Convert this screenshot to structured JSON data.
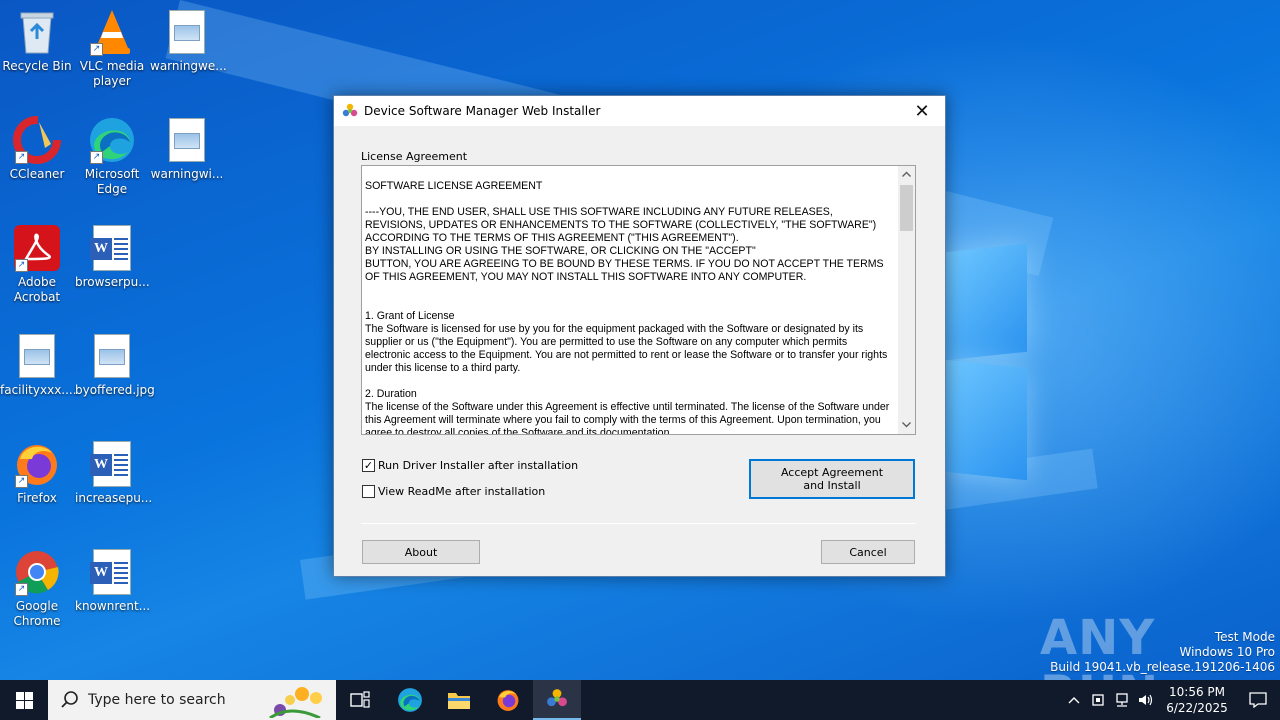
{
  "desktop": {
    "icons": [
      {
        "label": "Recycle Bin",
        "icon": "recycle-bin-icon"
      },
      {
        "label": "VLC media player",
        "icon": "vlc-icon"
      },
      {
        "label": "warningwe...",
        "icon": "image-file-icon"
      },
      {
        "label": "CCleaner",
        "icon": "ccleaner-icon"
      },
      {
        "label": "Microsoft Edge",
        "icon": "edge-icon"
      },
      {
        "label": "warningwi...",
        "icon": "image-file-icon"
      },
      {
        "label": "Adobe Acrobat",
        "icon": "acrobat-icon"
      },
      {
        "label": "browserpu...",
        "icon": "word-doc-icon"
      },
      {
        "label": "facilityxxx....",
        "icon": "image-file-icon"
      },
      {
        "label": "byoffered.jpg",
        "icon": "image-file-icon"
      },
      {
        "label": "Firefox",
        "icon": "firefox-icon"
      },
      {
        "label": "increasepu...",
        "icon": "word-doc-icon"
      },
      {
        "label": "Google Chrome",
        "icon": "chrome-icon"
      },
      {
        "label": "knownrent...",
        "icon": "word-doc-icon"
      }
    ]
  },
  "dialog": {
    "title": "Device Software Manager Web Installer",
    "close_glyph": "✕",
    "license_label": "License Agreement",
    "license_text": "SOFTWARE LICENSE AGREEMENT\n\n----YOU, THE END USER, SHALL USE THIS SOFTWARE INCLUDING ANY FUTURE RELEASES, REVISIONS, UPDATES OR ENHANCEMENTS TO THE SOFTWARE (COLLECTIVELY, \"THE SOFTWARE\") ACCORDING TO THE TERMS OF THIS AGREEMENT (\"THIS AGREEMENT\").\nBY INSTALLING OR USING THE SOFTWARE, OR CLICKING ON THE \"ACCEPT\"\nBUTTON, YOU ARE AGREEING TO BE BOUND BY THESE TERMS. IF YOU DO NOT ACCEPT THE TERMS OF THIS AGREEMENT, YOU MAY NOT INSTALL THIS SOFTWARE INTO ANY COMPUTER.\n\n\n1. Grant of License\nThe Software is licensed for use by you for the equipment packaged with the Software or designated by its supplier or us (\"the Equipment\"). You are permitted to use the Software on any computer which permits electronic access to the Equipment. You are not permitted to rent or lease the Software or to transfer your rights under this license to a third party.\n\n2. Duration\nThe license of the Software under this Agreement is effective until terminated. The license of the Software under this Agreement will terminate where you fail to comply with the terms of this Agreement. Upon termination, you agree to destroy all copies of the Software and its documentation.",
    "checkbox_run_driver": {
      "label": "Run Driver Installer after installation",
      "checked": true,
      "mark": "✓"
    },
    "checkbox_view_readme": {
      "label": "View ReadMe after installation",
      "checked": false,
      "mark": ""
    },
    "accept_label": "Accept Agreement\nand Install",
    "about_label": "About",
    "cancel_label": "Cancel"
  },
  "watermark": {
    "text": "ANY RUN"
  },
  "system_info": {
    "line1": "Test Mode",
    "line2": "Windows 10 Pro",
    "line3": "Build 19041.vb_release.191206-1406"
  },
  "taskbar": {
    "search_placeholder": "Type here to search",
    "clock_time": "10:56 PM",
    "clock_date": "6/22/2025"
  },
  "colors": {
    "accent": "#0078d7",
    "taskbar": "#101a2a",
    "desktop": "#0a6ad6"
  }
}
